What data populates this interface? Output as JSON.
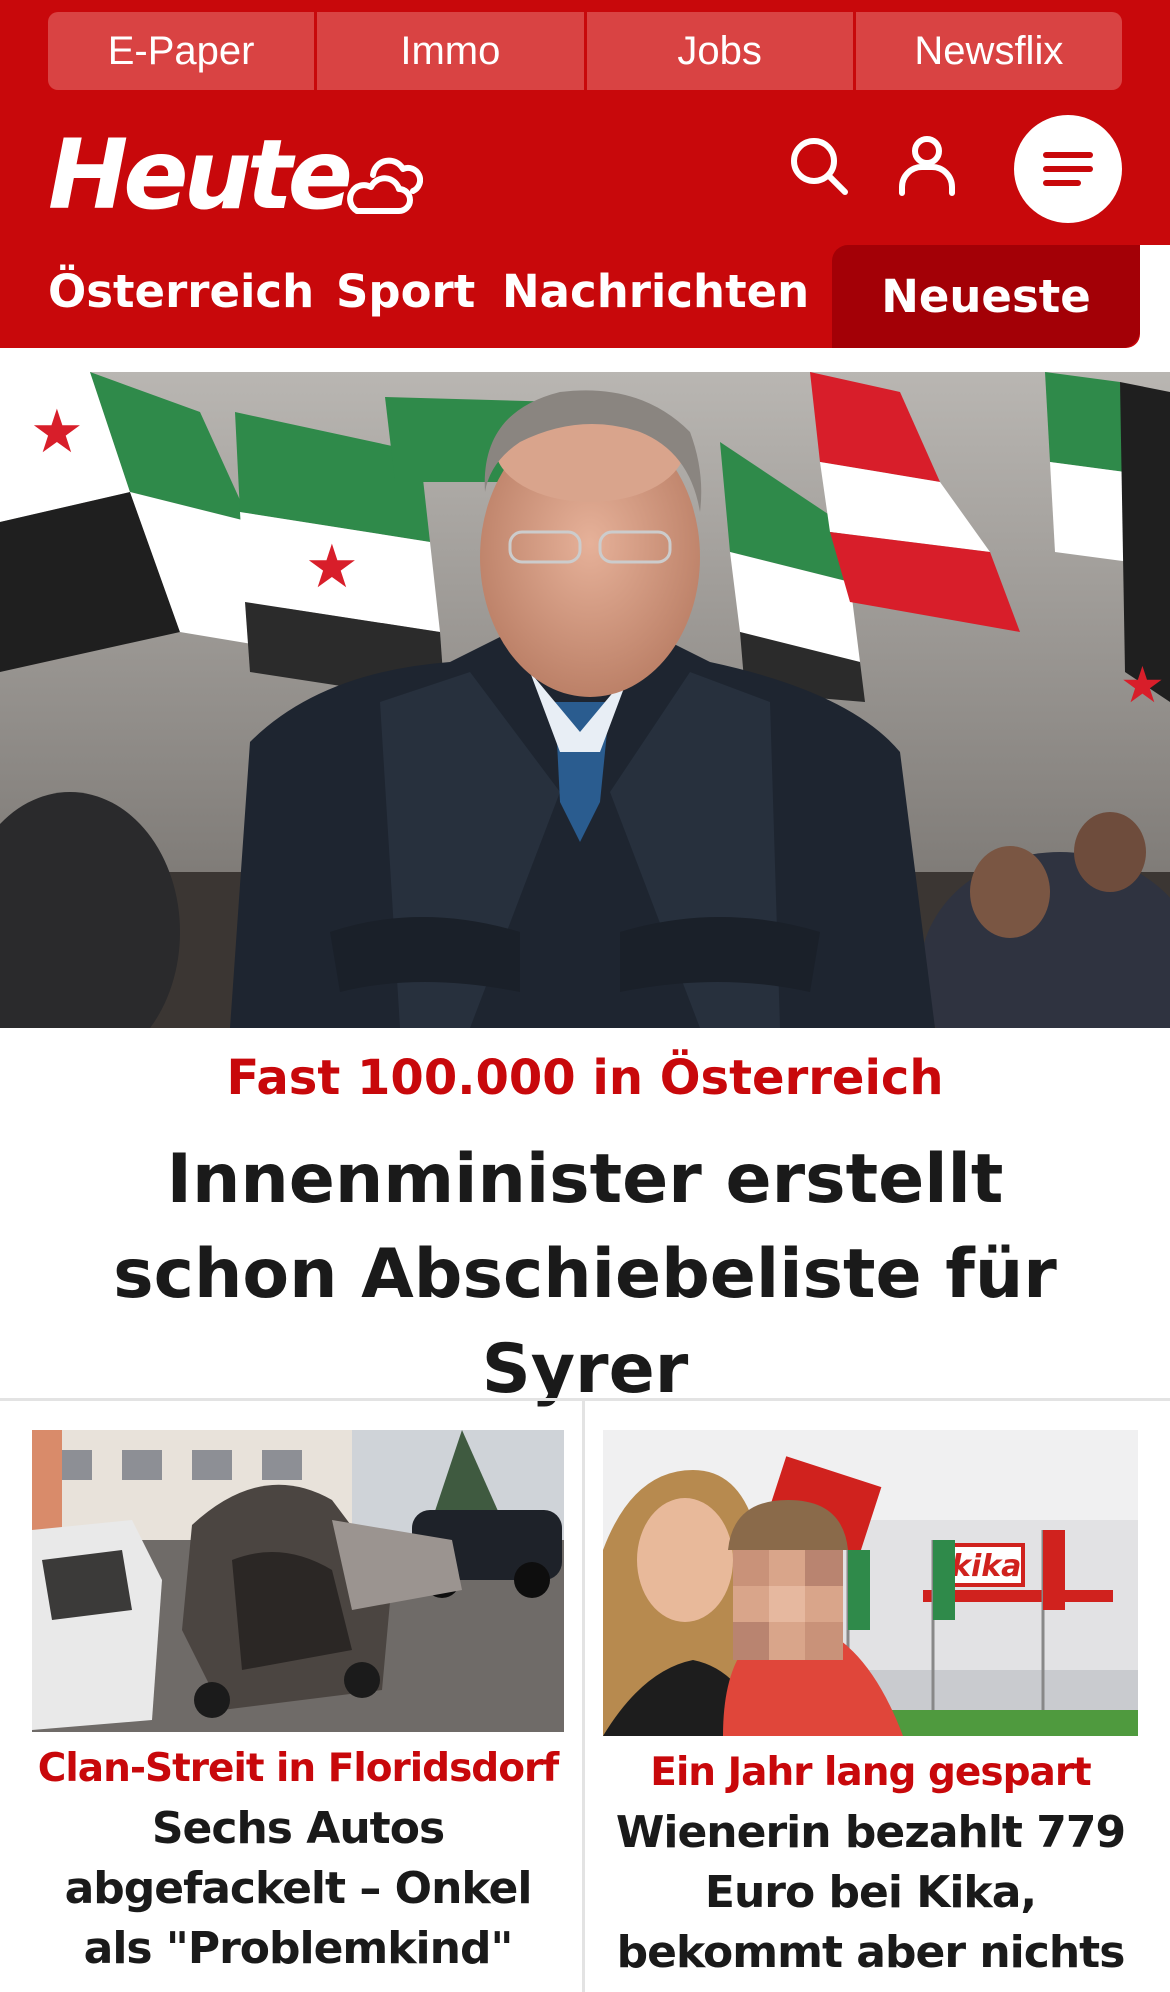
{
  "topnav": {
    "items": [
      {
        "label": "E-Paper"
      },
      {
        "label": "Immo"
      },
      {
        "label": "Jobs"
      },
      {
        "label": "Newsflix"
      }
    ]
  },
  "header": {
    "logo_text": "Heute",
    "weather_icon": "partly-cloudy-icon",
    "search_icon": "search-icon",
    "user_icon": "user-icon",
    "menu_icon": "hamburger-menu-icon"
  },
  "sections": {
    "items": [
      {
        "label": "Österreich"
      },
      {
        "label": "Sport"
      },
      {
        "label": "Nachrichten"
      }
    ],
    "active_label": "Neueste"
  },
  "hero": {
    "kicker": "Fast 100.000 in Österreich",
    "title": "Innenminister erstellt schon Abschiebeliste für Syrer"
  },
  "articles": [
    {
      "kicker": "Clan-Streit in Floridsdorf",
      "title": "Sechs Autos abgefackelt – Onkel als \"Problemkind\""
    },
    {
      "kicker": "Ein Jahr lang gespart",
      "title": "Wienerin bezahlt 779 Euro bei Kika, bekommt aber nichts"
    }
  ],
  "colors": {
    "brand_red": "#c8080b",
    "dark_red": "#a30006",
    "topnav_red": "#d94343",
    "text": "#1a1a1a"
  }
}
